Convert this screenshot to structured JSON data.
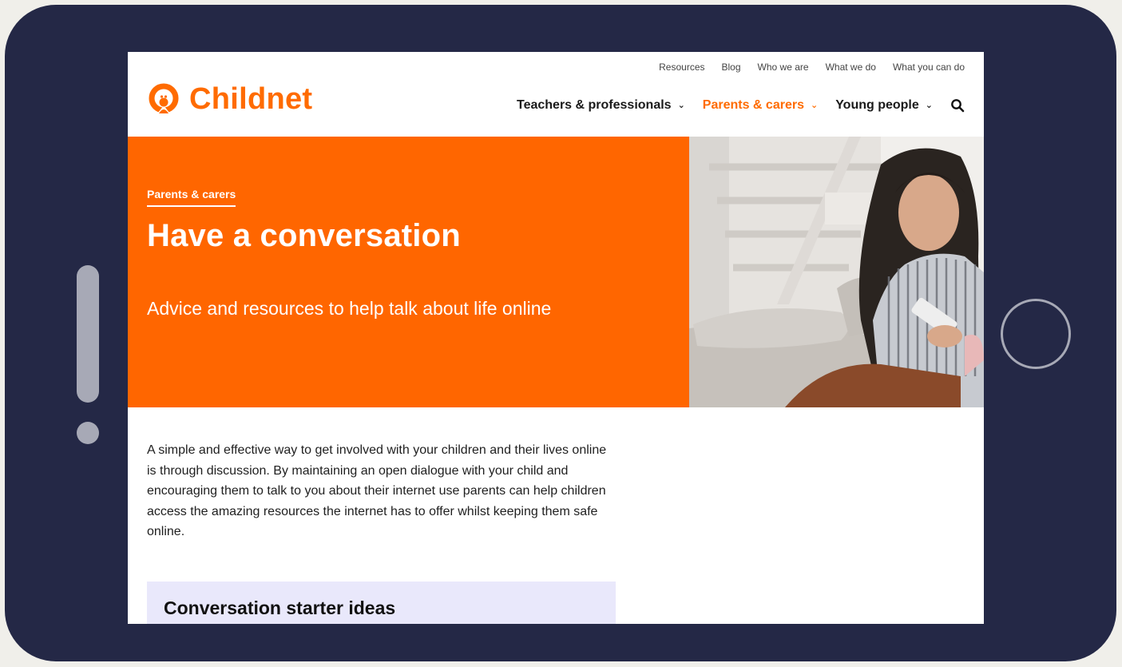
{
  "brand": {
    "name": "Childnet",
    "color": "#ff6b00",
    "logo_icon": "childnet-logo-icon"
  },
  "utility_nav": [
    "Resources",
    "Blog",
    "Who we are",
    "What we do",
    "What you can do"
  ],
  "main_nav": [
    {
      "label": "Teachers & professionals",
      "active": false
    },
    {
      "label": "Parents & carers",
      "active": true
    },
    {
      "label": "Young people",
      "active": false
    }
  ],
  "search": {
    "icon": "search-icon"
  },
  "hero": {
    "breadcrumb": "Parents & carers",
    "title": "Have a conversation",
    "subtitle": "Advice and resources to help talk about life online",
    "background": "#ff6600",
    "image": "woman-with-phone-photo"
  },
  "intro": "A simple and effective way to get involved with your children and their lives online is through discussion. By maintaining an open dialogue with your child and encouraging them to talk to you about their internet use parents can help children access the amazing resources the internet has to offer whilst keeping them safe online.",
  "callout": {
    "title": "Conversation starter ideas",
    "background": "#e9e8fb"
  },
  "device": {
    "frame_color": "#242846"
  }
}
